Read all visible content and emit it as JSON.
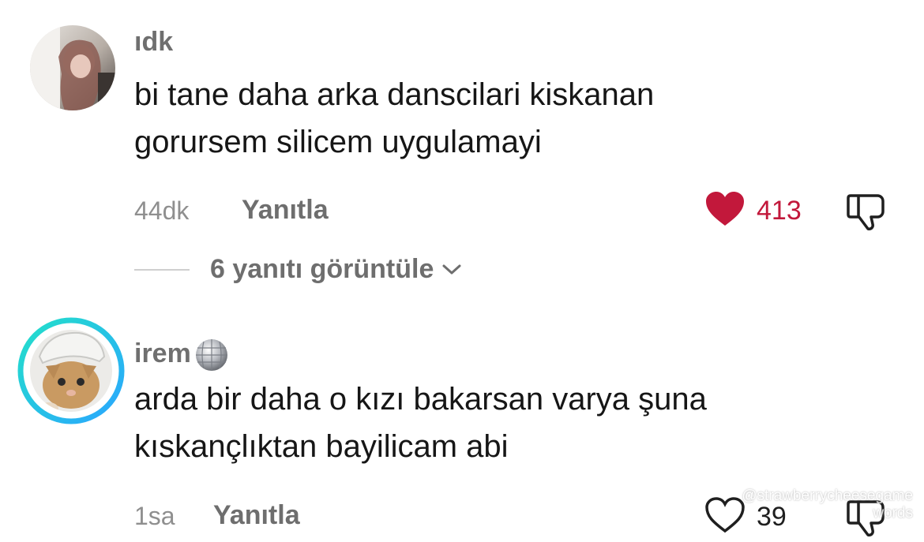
{
  "comments": [
    {
      "username": "ıdk",
      "text_lines": [
        "bi tane daha arka danscilari kiskanan",
        "gorursem silicem uygulamayi"
      ],
      "time": "44dk",
      "reply_label": "Yanıtla",
      "like_count": "413",
      "liked": true,
      "view_replies_label": "6 yanıtı görüntüle"
    },
    {
      "username": "irem",
      "username_emoji": "disco-ball",
      "text_lines": [
        "arda bir daha o kızı bakarsan varya şuna",
        "kıskançlıktan bayilicam abi"
      ],
      "time": "1sa",
      "reply_label": "Yanıtla",
      "like_count": "39",
      "liked": false
    }
  ],
  "watermark": {
    "line1": "@strawberrycheesegame",
    "line2": "words"
  },
  "colors": {
    "like_red": "#c2183b",
    "secondary_text": "#8f8f8f",
    "story_ring": [
      "#23e0c9",
      "#2aa6ff"
    ]
  },
  "icons": [
    "heart-filled-icon",
    "heart-outline-icon",
    "thumbs-down-icon",
    "chevron-down-icon",
    "disco-ball-icon"
  ]
}
